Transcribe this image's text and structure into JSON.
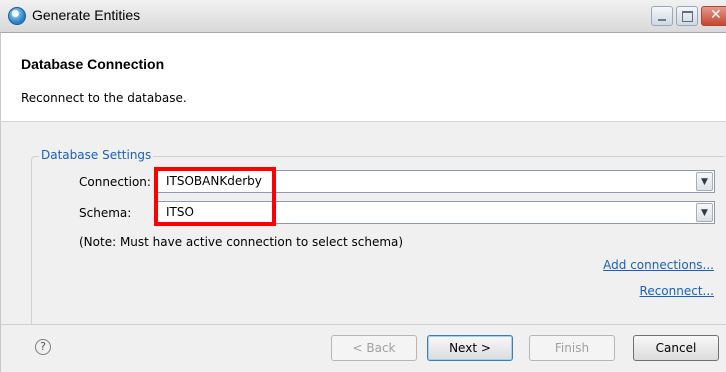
{
  "window": {
    "title": "Generate Entities"
  },
  "header": {
    "title": "Database Connection",
    "description": "Reconnect to the database."
  },
  "settings": {
    "group_label": "Database Settings",
    "connection_label": "Connection:",
    "connection_value": "ITSOBANKderby",
    "schema_label": "Schema:",
    "schema_value": "ITSO",
    "note": "(Note:  Must have active connection to select schema)",
    "add_connections_link": "Add connections...",
    "reconnect_link": "Reconnect..."
  },
  "footer": {
    "help_glyph": "?",
    "back_label": "< Back",
    "next_label": "Next >",
    "finish_label": "Finish",
    "cancel_label": "Cancel"
  },
  "colors": {
    "highlight": "#ff0000",
    "link": "#1a5fc4",
    "close_button": "#c4462f"
  },
  "icons": [
    "app-icon",
    "minimize-icon",
    "maximize-icon",
    "close-icon",
    "dropdown-arrow-icon",
    "help-icon"
  ]
}
